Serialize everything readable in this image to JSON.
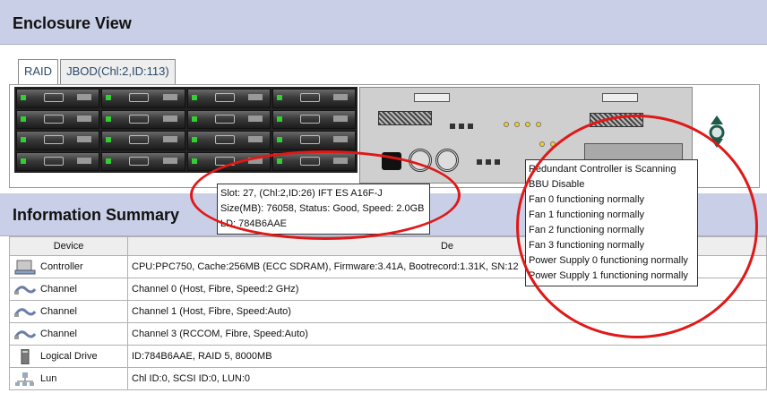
{
  "enclosure": {
    "title": "Enclosure View"
  },
  "tabs": [
    {
      "label": "RAID",
      "active": true
    },
    {
      "label": "JBOD(Chl:2,ID:113)",
      "active": false
    }
  ],
  "info_summary": {
    "title": "Information Summary"
  },
  "table": {
    "headers": [
      "Device",
      "De"
    ],
    "rows": [
      {
        "device": "Controller",
        "icon": "controller-icon",
        "description": "CPU:PPC750, Cache:256MB (ECC SDRAM), Firmware:3.41A, Bootrecord:1.31K, SN:12"
      },
      {
        "device": "Channel",
        "icon": "channel-icon",
        "description": "Channel 0 (Host, Fibre, Speed:2 GHz)"
      },
      {
        "device": "Channel",
        "icon": "channel-icon",
        "description": "Channel 1 (Host, Fibre, Speed:Auto)"
      },
      {
        "device": "Channel",
        "icon": "channel-icon",
        "description": "Channel 3 (RCCOM, Fibre, Speed:Auto)"
      },
      {
        "device": "Logical Drive",
        "icon": "logical-drive-icon",
        "description": "ID:784B6AAE, RAID 5, 8000MB"
      },
      {
        "device": "Lun",
        "icon": "lun-icon",
        "description": "Chl ID:0, SCSI ID:0, LUN:0"
      }
    ]
  },
  "drive_tooltip": {
    "lines": [
      "Slot: 27, (Chl:2,ID:26) IFT ES A16F-J",
      "Size(MB): 76058, Status: Good, Speed: 2.0GB",
      "LD: 784B6AAE"
    ]
  },
  "status_tooltip": {
    "lines": [
      "Redundant Controller is Scanning",
      "BBU Disable",
      "Fan 0 functioning normally",
      "Fan 1 functioning normally",
      "Fan 2 functioning normally",
      "Fan 3 functioning normally",
      "Power Supply 0 functioning normally",
      "Power Supply 1 functioning normally"
    ]
  },
  "colors": {
    "header_bg": "#c9cfe6",
    "annotation_red": "#e01818",
    "drive_led": "#2fd02f"
  }
}
